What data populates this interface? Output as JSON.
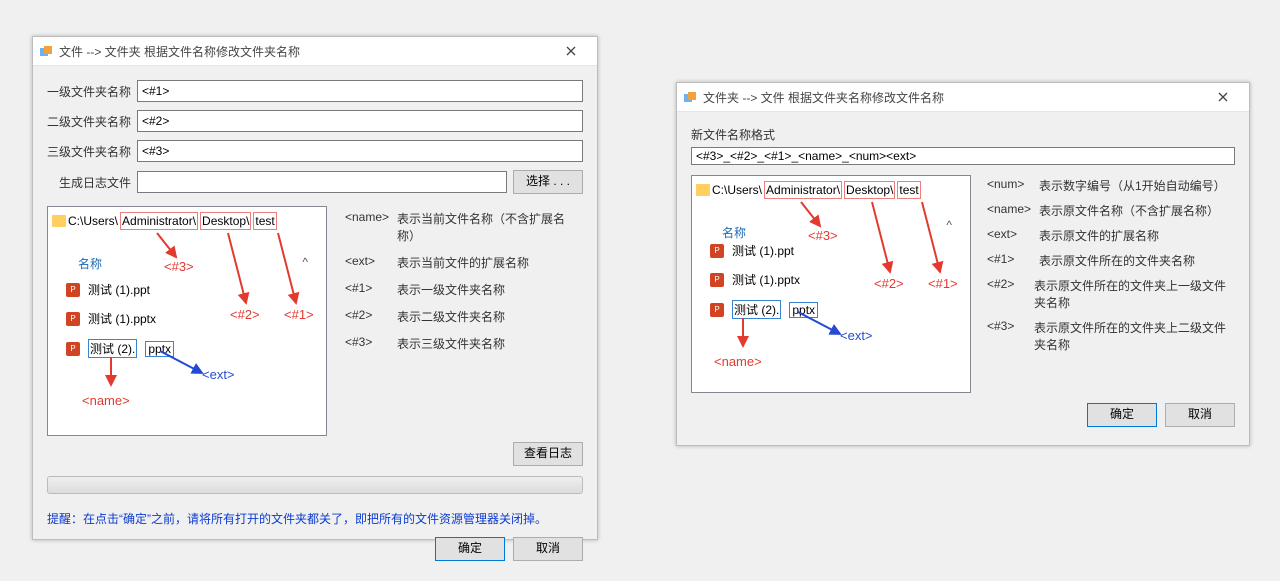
{
  "win1": {
    "title": "文件 --> 文件夹 根据文件名称修改文件夹名称",
    "fields": {
      "l1_label": "一级文件夹名称",
      "l1_value": "<#1>",
      "l2_label": "二级文件夹名称",
      "l2_value": "<#2>",
      "l3_label": "三级文件夹名称",
      "l3_value": "<#3>",
      "log_label": "生成日志文件",
      "log_value": "",
      "browse": "选择 . . ."
    },
    "addr": {
      "seg1": "C:\\Users\\",
      "seg2": "Administrator\\",
      "seg3": "Desktop\\",
      "seg4": "test"
    },
    "list_header": "名称",
    "files": [
      "测试 (1).ppt",
      "测试 (1).pptx"
    ],
    "sel": {
      "name": "测试 (2).",
      "ext": "pptx"
    },
    "callouts": {
      "h3": "<#3>",
      "h2": "<#2>",
      "h1": "<#1>",
      "ext": "<ext>",
      "name": "<name>"
    },
    "legend": [
      {
        "k": "<name>",
        "v": "表示当前文件名称（不含扩展名称）"
      },
      {
        "k": "<ext>",
        "v": "表示当前文件的扩展名称"
      },
      {
        "k": "<#1>",
        "v": "表示一级文件夹名称"
      },
      {
        "k": "<#2>",
        "v": "表示二级文件夹名称"
      },
      {
        "k": "<#3>",
        "v": "表示三级文件夹名称"
      }
    ],
    "view_log": "查看日志",
    "warn": "提醒：在点击“确定”之前，请将所有打开的文件夹都关了，即把所有的文件资源管理器关闭掉。",
    "ok": "确定",
    "cancel": "取消"
  },
  "win2": {
    "title": "文件夹 --> 文件 根据文件夹名称修改文件名称",
    "fmt_label": "新文件名称格式",
    "fmt_value": "<#3>_<#2>_<#1>_<name>_<num><ext>",
    "addr": {
      "seg1": "C:\\Users\\",
      "seg2": "Administrator\\",
      "seg3": "Desktop\\",
      "seg4": "test"
    },
    "list_header": "名称",
    "files": [
      "测试 (1).ppt",
      "测试 (1).pptx"
    ],
    "sel": {
      "name": "测试 (2).",
      "ext": "pptx"
    },
    "callouts": {
      "h3": "<#3>",
      "h2": "<#2>",
      "h1": "<#1>",
      "ext": "<ext>",
      "name": "<name>"
    },
    "legend": [
      {
        "k": "<num>",
        "v": "表示数字编号（从1开始自动编号）"
      },
      {
        "k": "<name>",
        "v": "表示原文件名称（不含扩展名称）"
      },
      {
        "k": "<ext>",
        "v": "表示原文件的扩展名称"
      },
      {
        "k": "<#1>",
        "v": "表示原文件所在的文件夹名称"
      },
      {
        "k": "<#2>",
        "v": "表示原文件所在的文件夹上一级文件夹名称"
      },
      {
        "k": "<#3>",
        "v": "表示原文件所在的文件夹上二级文件夹名称"
      }
    ],
    "ok": "确定",
    "cancel": "取消"
  }
}
